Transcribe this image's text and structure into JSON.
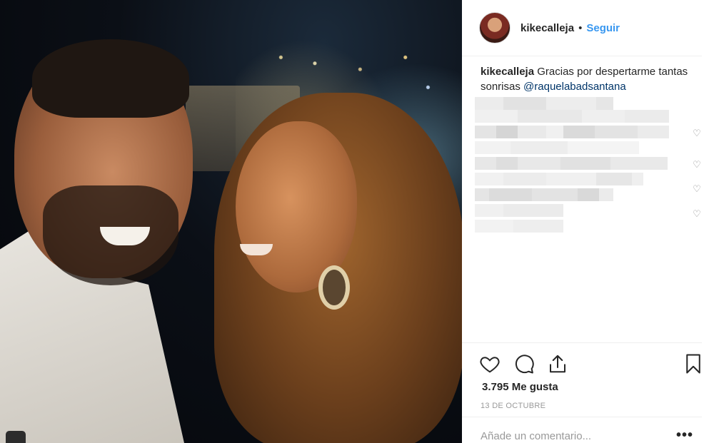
{
  "post": {
    "username": "kikecalleja",
    "separator": "•",
    "follow_label": "Seguir",
    "caption": {
      "username": "kikecalleja",
      "text": "Gracias por despertarme tantas sonrisas",
      "mention": "@raquelabadsantana"
    },
    "likes": "3.795 Me gusta",
    "date": "13 DE OCTUBRE",
    "comment_placeholder": "Añade un comentario...",
    "more_label": "•••"
  },
  "icons": {
    "like": "heart-icon",
    "comment": "comment-icon",
    "share": "share-icon",
    "save": "bookmark-icon",
    "comment_like": "heart-small-icon"
  },
  "colors": {
    "follow": "#3897f0",
    "mention": "#003569",
    "muted": "#999999",
    "text": "#262626"
  }
}
